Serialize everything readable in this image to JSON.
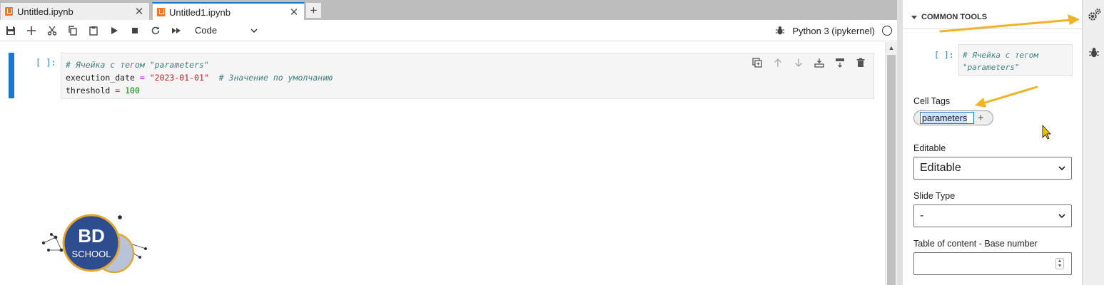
{
  "tabs": [
    {
      "label": "Untitled.ipynb",
      "active": false
    },
    {
      "label": "Untitled1.ipynb",
      "active": true
    }
  ],
  "toolbar": {
    "cell_type": "Code",
    "kernel_name": "Python 3 (ipykernel)"
  },
  "cell": {
    "prompt": "[ ]:",
    "lines": {
      "line1_comment": "# Ячейка с тегом \"parameters\"",
      "line2_var": "execution_date",
      "line2_eq": " = ",
      "line2_string": "\"2023-01-01\"",
      "line2_comment": "# Значение по умолчанию",
      "line3_var": "threshold",
      "line3_eq": " = ",
      "line3_number": "100"
    }
  },
  "logo": {
    "line1": "BD",
    "line2": "SCHOOL"
  },
  "sidebar": {
    "section_title": "COMMON TOOLS",
    "preview_prompt": "[ ]:",
    "preview_code_line1": "# Ячейка с тегом",
    "preview_code_line2": "\"parameters\"",
    "cell_tags_label": "Cell Tags",
    "tag_value": "parameters",
    "editable_label": "Editable",
    "editable_value": "Editable",
    "slide_type_label": "Slide Type",
    "slide_type_value": "-",
    "toc_label": "Table of content - Base number",
    "toc_value": ""
  },
  "colors": {
    "accent": "#1976d2",
    "arrow": "#f0b323",
    "notebook_icon": "#f37626"
  }
}
